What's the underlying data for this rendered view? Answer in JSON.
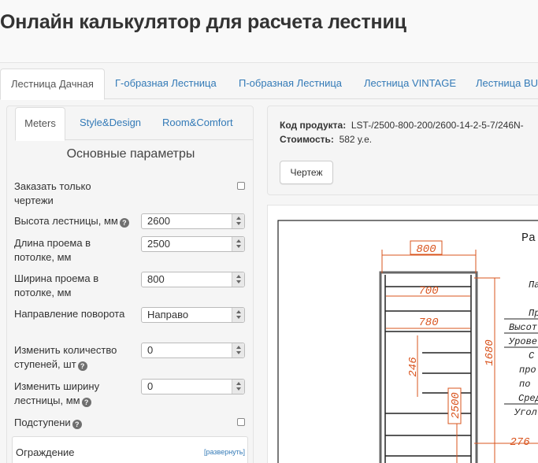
{
  "header": {
    "title": "Онлайн калькулятор для расчета лестниц"
  },
  "main_tabs": [
    {
      "label": "Лестница Дачная",
      "active": true
    },
    {
      "label": "Г-образная Лестница",
      "active": false
    },
    {
      "label": "П-образная Лестница",
      "active": false
    },
    {
      "label": "Лестница VINTAGE",
      "active": false
    },
    {
      "label": "Лестница BUT",
      "active": false
    }
  ],
  "left": {
    "sub_tabs": [
      {
        "label": "Meters",
        "active": true
      },
      {
        "label": "Style&Design",
        "active": false
      },
      {
        "label": "Room&Comfort",
        "active": false
      }
    ],
    "title": "Основные параметры",
    "params": {
      "drawings_only": {
        "label_1": "Заказать только",
        "label_2": "чертежи",
        "checked": false
      },
      "height": {
        "label": "Высота лестницы, мм",
        "value": "2600"
      },
      "opening_length": {
        "label_1": "Длина проема в",
        "label_2": "потолке, мм",
        "value": "2500"
      },
      "opening_width": {
        "label_1": "Ширина проема в",
        "label_2": "потолке, мм",
        "value": "800"
      },
      "turn_direction": {
        "label": "Направление поворота",
        "value": "Направо"
      },
      "steps_count": {
        "label_1": "Изменить количество",
        "label_2": "ступеней, шт",
        "value": "0"
      },
      "stair_width": {
        "label_1": "Изменить ширину",
        "label_2": "лестницы, мм",
        "value": "0"
      },
      "risers": {
        "label": "Подступени",
        "checked": false
      }
    },
    "fence": {
      "label": "Ограждение",
      "expand_link": "[развернуть]"
    }
  },
  "right": {
    "product_code_label": "Код продукта:",
    "product_code_value": "LST-/2500-800-200/2600-14-2-5-7/246N-",
    "price_label": "Стоимость:",
    "price_value": "582 у.е.",
    "drawing_button": "Чертеж"
  },
  "drawing": {
    "header_text": "Ра",
    "dims": {
      "top": "800",
      "d700": "700",
      "d780": "780",
      "d246": "246",
      "d2500": "2500",
      "d1680": "1680",
      "d276": "276"
    },
    "table_rows": [
      "Па",
      "Пр",
      "Высот",
      "Урове",
      "С",
      "про",
      "по",
      "Сред",
      "Угол"
    ],
    "accent_color": "#d9541e"
  },
  "help_icon_glyph": "?"
}
